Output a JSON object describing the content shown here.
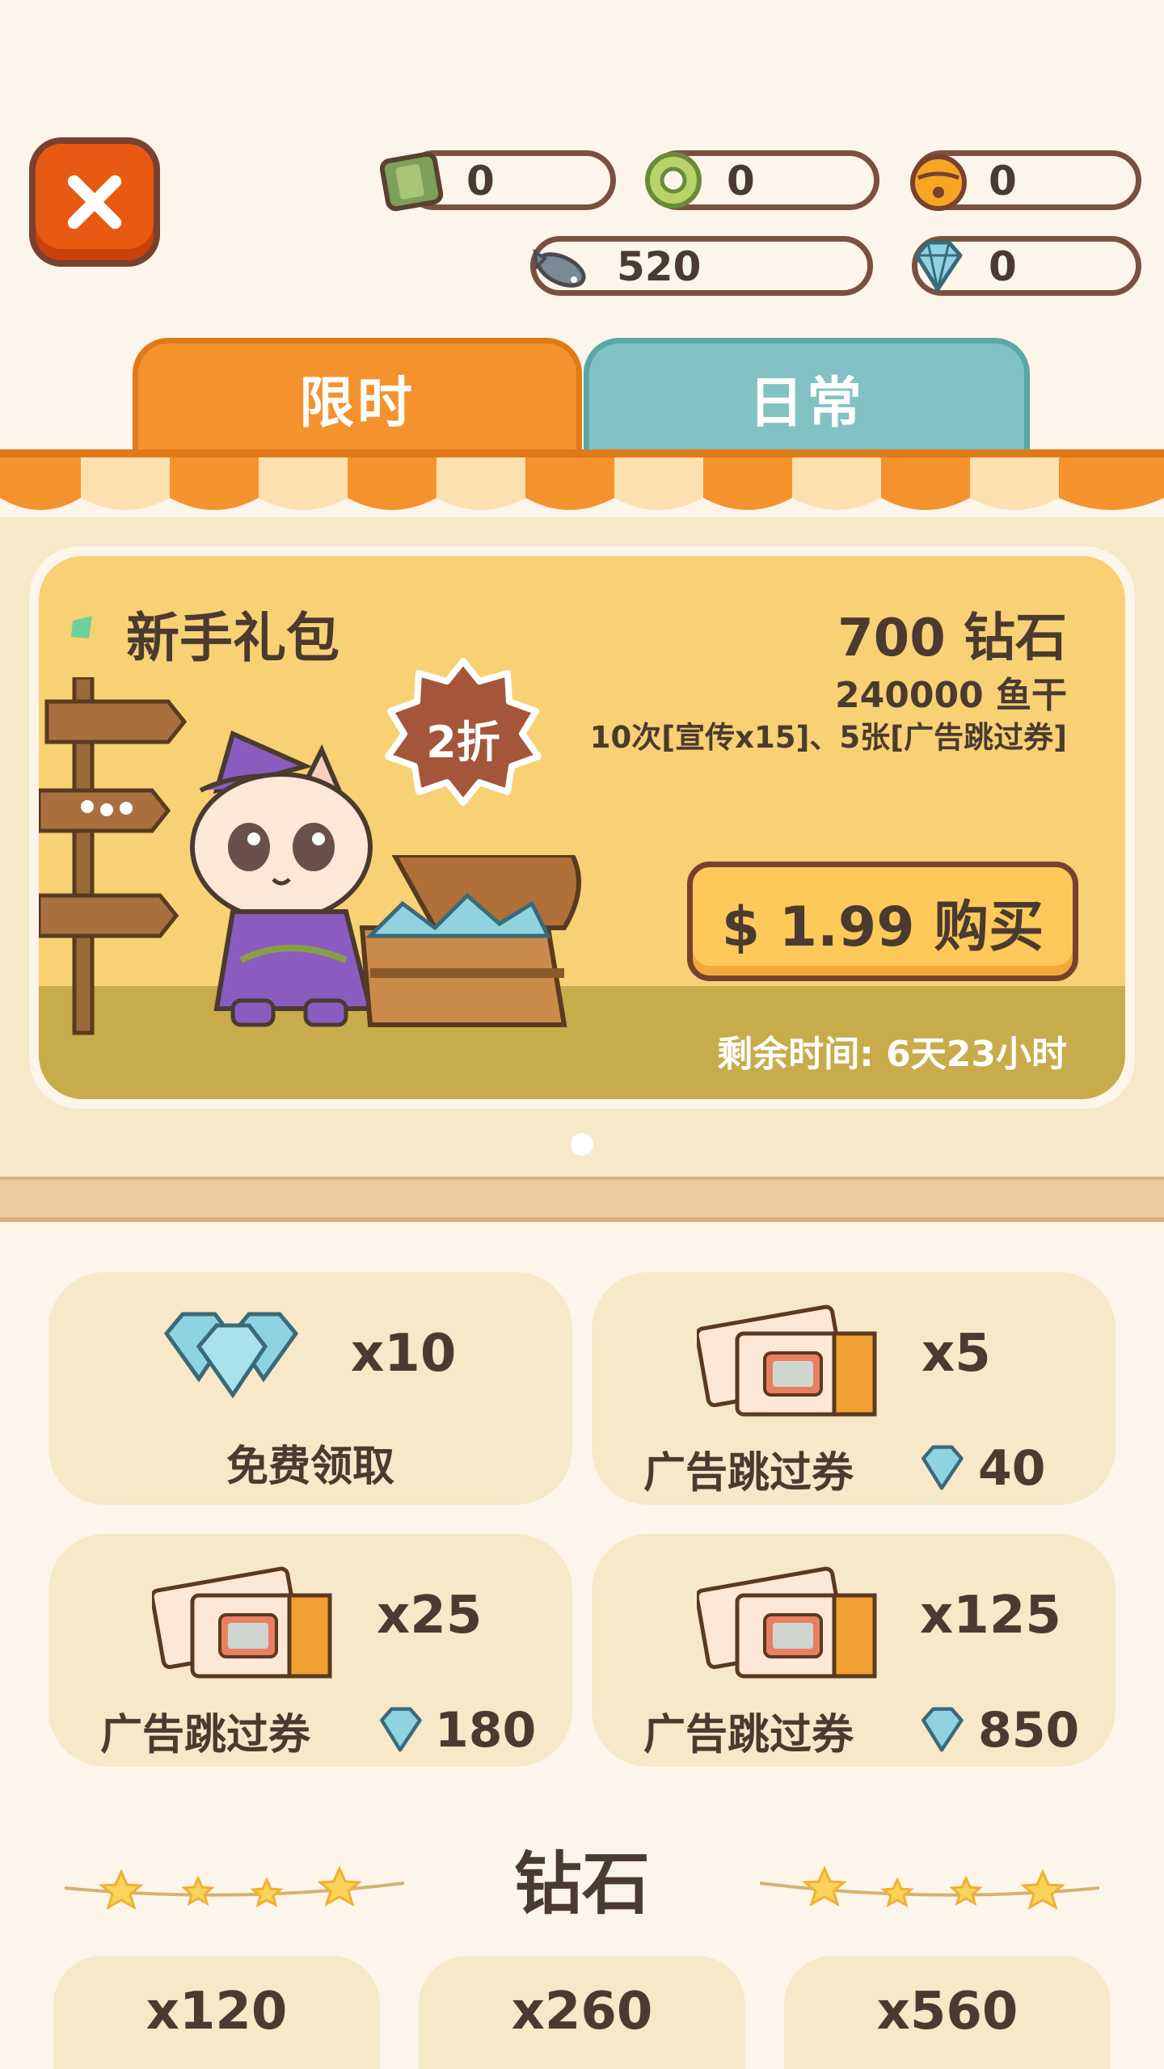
{
  "currencies": {
    "cash": {
      "value": "0",
      "icon": "cash-wallet-icon"
    },
    "ring": {
      "value": "0",
      "icon": "green-ring-icon"
    },
    "bell": {
      "value": "0",
      "icon": "golden-bell-icon"
    },
    "fish": {
      "value": "520",
      "icon": "dried-fish-icon"
    },
    "diamond": {
      "value": "0",
      "icon": "diamond-icon"
    }
  },
  "tabs": [
    {
      "label": "限时",
      "color": "#f4922e"
    },
    {
      "label": "日常",
      "color": "#82c1c4"
    }
  ],
  "promo": {
    "title": "新手礼包",
    "diamonds": "700 钻石",
    "fish": "240000 鱼干",
    "extras": "10次[宣传x15]、5张[广告跳过券]",
    "discount": "2折",
    "buy_label": "$ 1.99 购买",
    "remaining": "剩余时间: 6天23小时"
  },
  "items": [
    {
      "qty": "x10",
      "label": "免费领取",
      "icon": "diamonds-icon",
      "price": ""
    },
    {
      "qty": "x5",
      "label": "广告跳过券",
      "icon": "ad-skip-ticket-icon",
      "price": "40"
    },
    {
      "qty": "x25",
      "label": "广告跳过券",
      "icon": "ad-skip-ticket-icon",
      "price": "180"
    },
    {
      "qty": "x125",
      "label": "广告跳过券",
      "icon": "ad-skip-ticket-icon",
      "price": "850"
    }
  ],
  "diamond_section": {
    "title": "钻石",
    "packs": [
      {
        "qty": "x120"
      },
      {
        "qty": "x260"
      },
      {
        "qty": "x560"
      }
    ]
  },
  "colors": {
    "accent_orange": "#f4922e",
    "accent_teal": "#82c1c4",
    "close_red": "#e85a12",
    "card_bg": "#f6e8c8",
    "promo_bg": "#f7d173"
  }
}
